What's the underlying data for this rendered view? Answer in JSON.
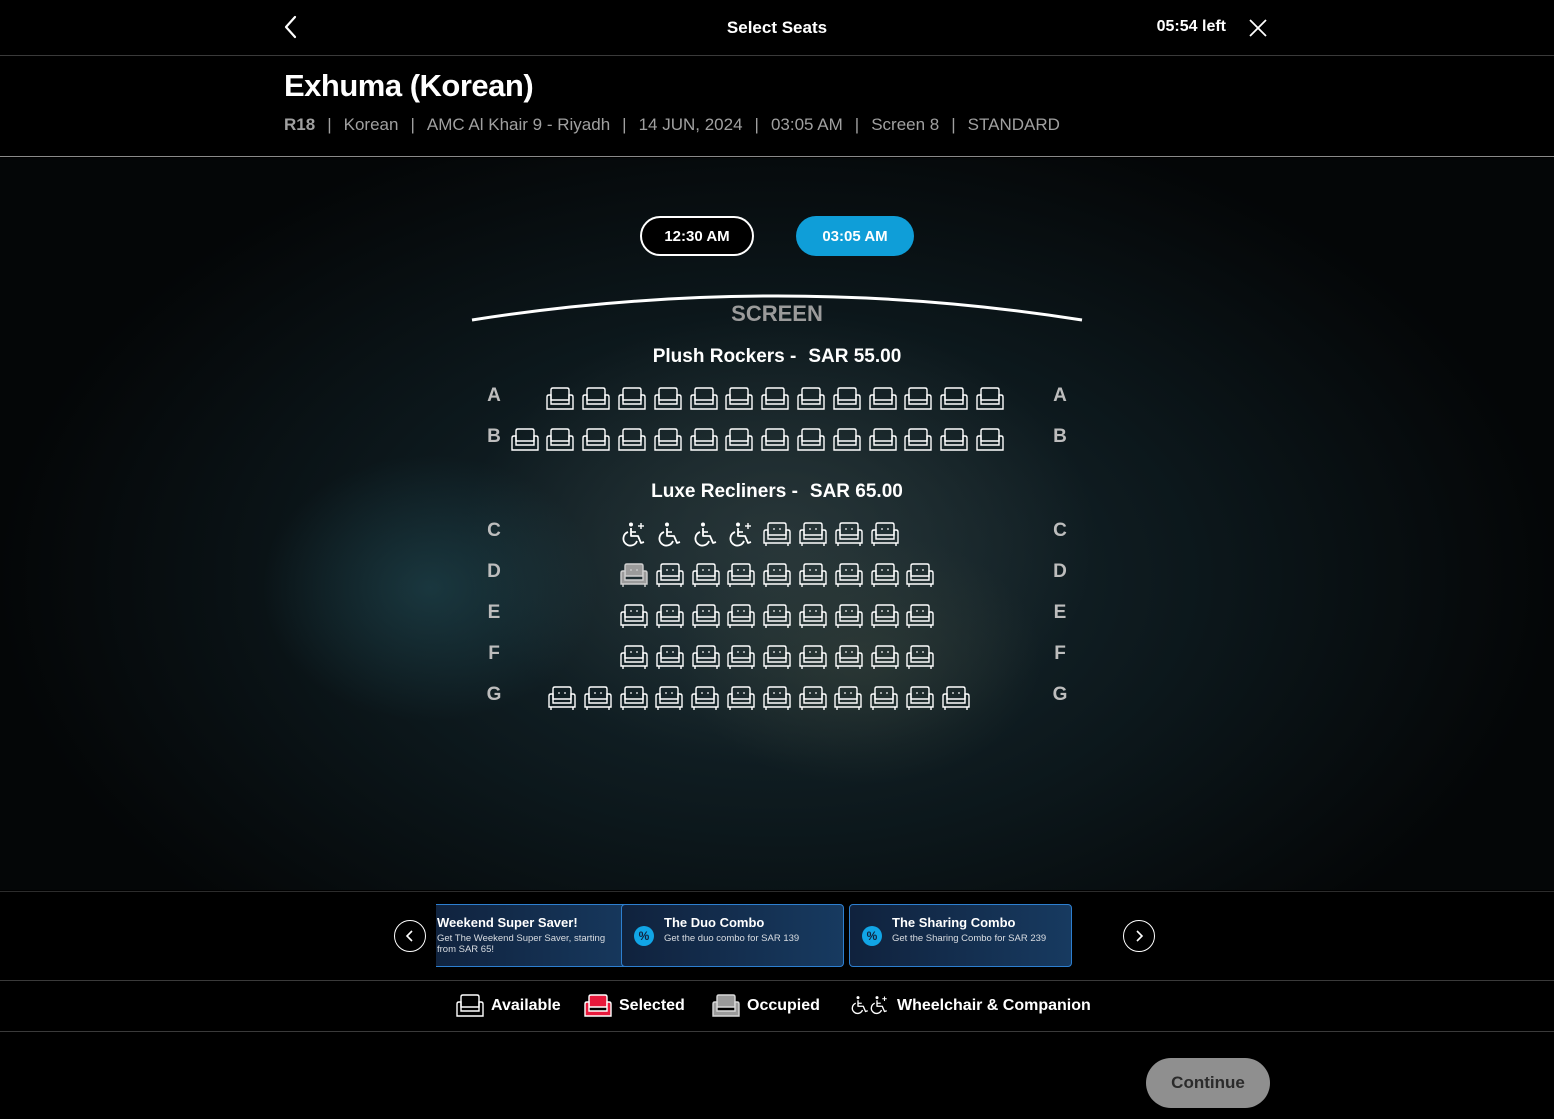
{
  "header": {
    "title": "Select Seats",
    "timer": "05:54 left"
  },
  "movie": {
    "title": "Exhuma (Korean)",
    "rating": "R18",
    "language": "Korean",
    "cinema": "AMC Al Khair 9 - Riyadh",
    "date": "14 JUN, 2024",
    "time": "03:05 AM",
    "screen": "Screen 8",
    "format": "STANDARD"
  },
  "showtimes": [
    {
      "label": "12:30 AM",
      "selected": false
    },
    {
      "label": "03:05 AM",
      "selected": true
    }
  ],
  "screen_label": "SCREEN",
  "sections": [
    {
      "name": "Plush Rockers -",
      "price": "SAR  55.00",
      "rows": [
        {
          "label": "A",
          "seats": [
            "available",
            "available",
            "available",
            "available",
            "available",
            "available",
            "available",
            "available",
            "available",
            "available",
            "available",
            "available",
            "available"
          ]
        },
        {
          "label": "B",
          "seats": [
            "available",
            "available",
            "available",
            "available",
            "available",
            "available",
            "available",
            "available",
            "available",
            "available",
            "available",
            "available",
            "available",
            "available"
          ]
        }
      ]
    },
    {
      "name": "Luxe Recliners -",
      "price": "SAR  65.00",
      "rows": [
        {
          "label": "C",
          "seats": [
            "companion",
            "wheelchair",
            "wheelchair",
            "companion",
            "available",
            "available",
            "available",
            "available"
          ]
        },
        {
          "label": "D",
          "seats": [
            "occupied",
            "available",
            "available",
            "available",
            "available",
            "available",
            "available",
            "available",
            "available"
          ]
        },
        {
          "label": "E",
          "seats": [
            "available",
            "available",
            "available",
            "available",
            "available",
            "available",
            "available",
            "available",
            "available"
          ]
        },
        {
          "label": "F",
          "seats": [
            "available",
            "available",
            "available",
            "available",
            "available",
            "available",
            "available",
            "available",
            "available"
          ]
        },
        {
          "label": "G",
          "seats": [
            "available",
            "available",
            "available",
            "available",
            "available",
            "available",
            "available",
            "available",
            "available",
            "available",
            "available",
            "available"
          ]
        }
      ]
    }
  ],
  "offers": [
    {
      "title": "Weekend Super Saver!",
      "desc": "Get The Weekend Super Saver, starting from SAR 65!",
      "badge": false
    },
    {
      "title": "The Duo Combo",
      "desc": "Get the duo combo for SAR 139",
      "badge": true
    },
    {
      "title": "The Sharing Combo",
      "desc": "Get the Sharing Combo for SAR 239",
      "badge": true
    }
  ],
  "legend": {
    "available": "Available",
    "selected": "Selected",
    "occupied": "Occupied",
    "wheelchair": "Wheelchair & Companion"
  },
  "colors": {
    "accent": "#0f9ed8",
    "selected": "#e8193c",
    "occupied": "#9b9b9b",
    "offer_border": "#2d7fd0"
  },
  "continue_label": "Continue"
}
